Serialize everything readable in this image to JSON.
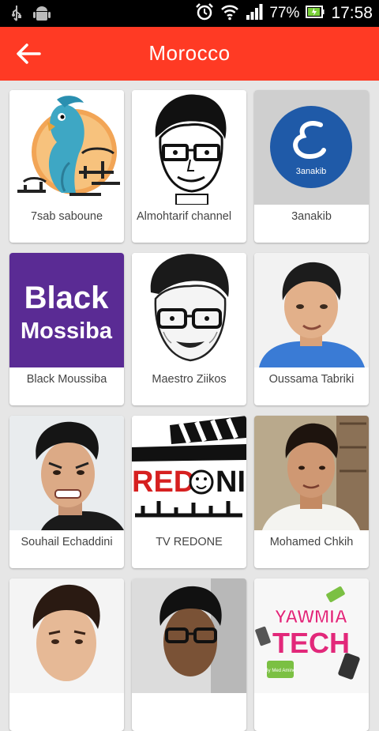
{
  "status_bar": {
    "battery": "77%",
    "time": "17:58"
  },
  "app_bar": {
    "title": "Morocco"
  },
  "channels": [
    {
      "name": "7sab saboune"
    },
    {
      "name": "Almohtarif channel"
    },
    {
      "name": "3anakib",
      "logo_text": "3anakib"
    },
    {
      "name": "Black Moussiba",
      "logo_line1": "Black",
      "logo_line2": "Mossiba"
    },
    {
      "name": "Maestro Ziikos"
    },
    {
      "name": "Oussama Tabriki"
    },
    {
      "name": "Souhail Echaddini"
    },
    {
      "name": "TV REDONE",
      "logo_top": "RED",
      "logo_mid": "NI"
    },
    {
      "name": "Mohamed Chkih"
    },
    {
      "name": ""
    },
    {
      "name": ""
    },
    {
      "name": "",
      "logo_line1": "YAWMIA",
      "logo_line2": "TECH",
      "logo_sub": "By Med Amine"
    }
  ]
}
